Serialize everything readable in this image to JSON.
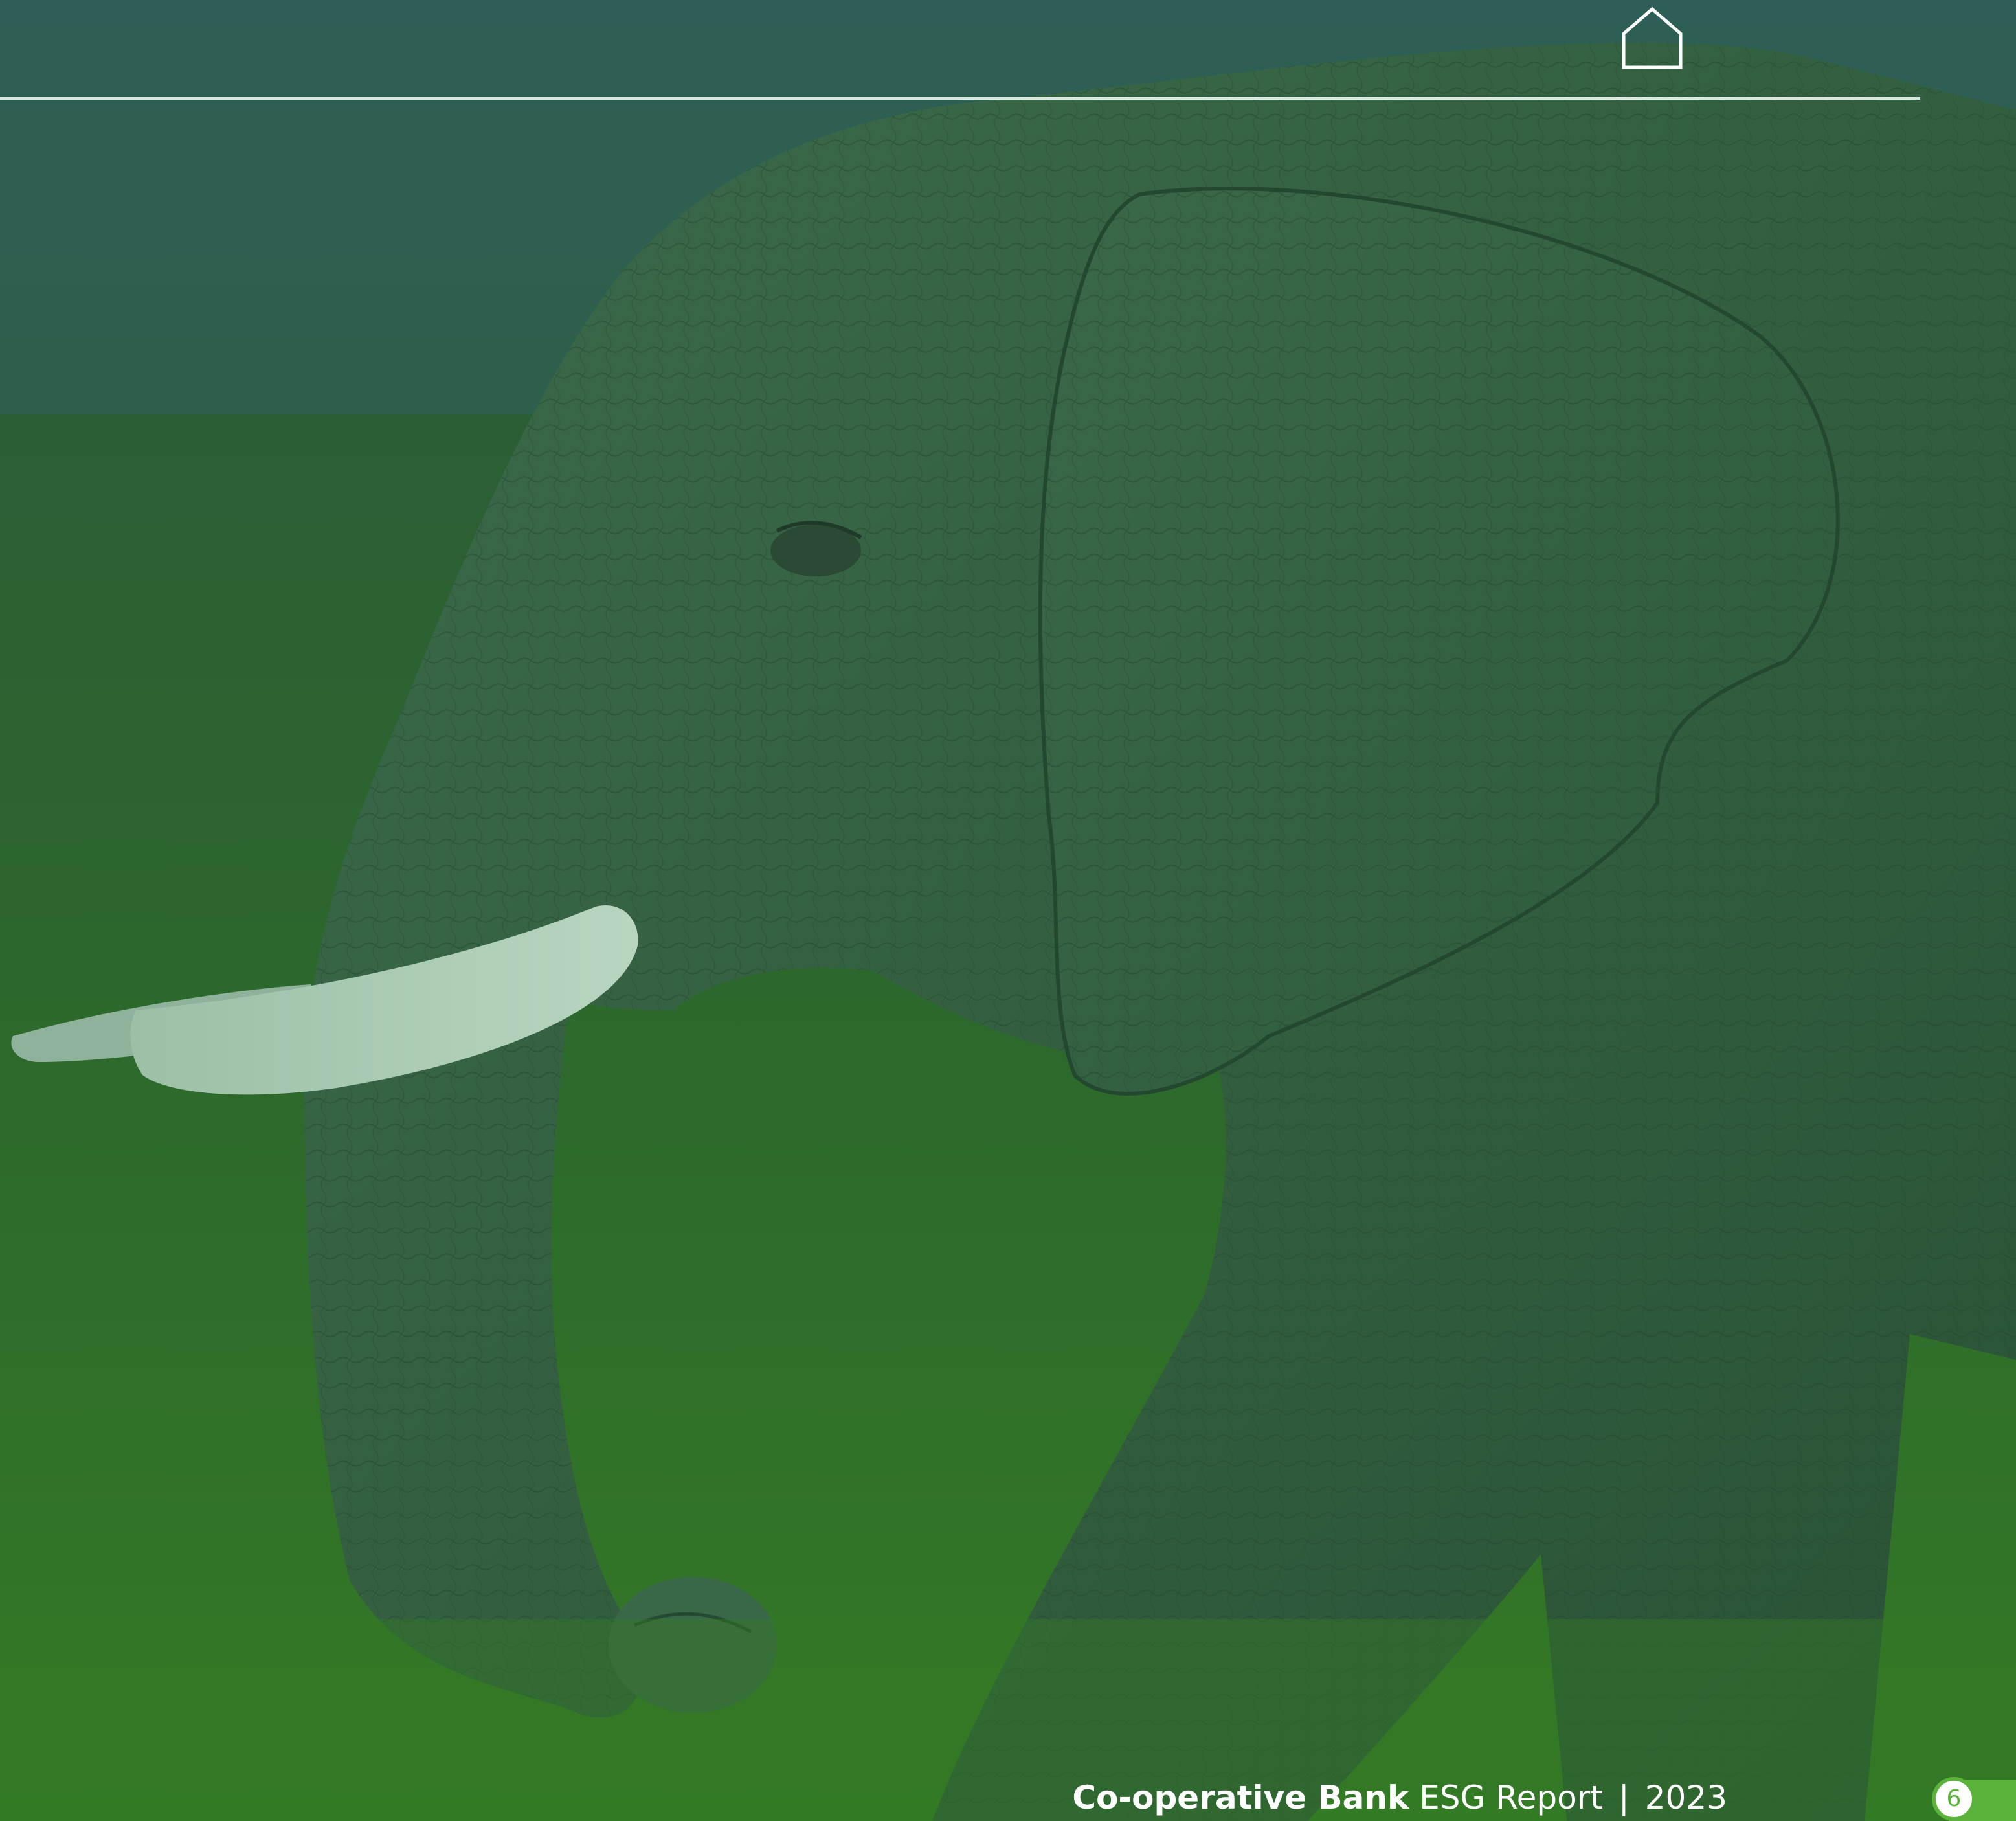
{
  "header": {
    "home_icon": "home-icon"
  },
  "photo": {
    "subject": "elephant-photo",
    "tint_color": "#2e6240"
  },
  "footer": {
    "brand": "Co-operative Bank",
    "report": "ESG Report",
    "separator": "|",
    "year": "2023",
    "page_number": "6",
    "accent_color": "#5cb33b"
  }
}
